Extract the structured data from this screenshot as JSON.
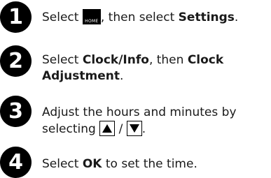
{
  "steps": [
    {
      "number": "1",
      "pre": "Select ",
      "icon_label": "HOME",
      "mid": ", then select ",
      "bold": "Settings",
      "post": "."
    },
    {
      "number": "2",
      "line1_pre": "Select ",
      "line1_bold1": "Clock/Info",
      "line1_mid": ", then ",
      "line1_bold2": "Clock",
      "line2_bold": "Adjustment",
      "line2_post": "."
    },
    {
      "number": "3",
      "line1": "Adjust the hours and minutes by",
      "line2_pre": "selecting ",
      "separator": " / ",
      "line2_post": "."
    },
    {
      "number": "4",
      "pre": "Select ",
      "bold": "OK",
      "post": " to set the time."
    }
  ],
  "icons": {
    "home": "home-menu-icon",
    "up": "up-arrow-icon",
    "down": "down-arrow-icon"
  }
}
